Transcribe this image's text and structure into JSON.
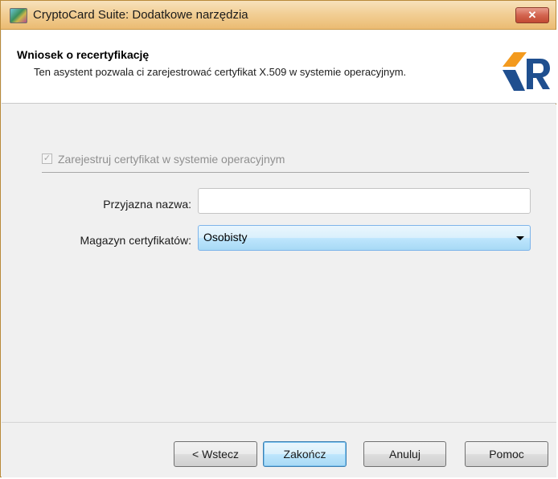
{
  "window": {
    "title": "CryptoCard Suite: Dodatkowe narzędzia",
    "close_label": "✕"
  },
  "header": {
    "title": "Wniosek o recertyfikację",
    "description": "Ten asystent pozwala ci zarejestrować certyfikat X.509 w systemie operacyjnym.",
    "logo_icon": "ccr-logo"
  },
  "form": {
    "register_checkbox": {
      "label": "Zarejestruj certyfikat w systemie operacyjnym",
      "checked": true,
      "enabled": false,
      "check_glyph": "✓"
    },
    "friendly_name": {
      "label": "Przyjazna nazwa:",
      "value": ""
    },
    "cert_store": {
      "label": "Magazyn certyfikatów:",
      "value": "Osobisty"
    }
  },
  "buttons": {
    "back": "< Wstecz",
    "finish": "Zakończ",
    "cancel": "Anuluj",
    "help": "Pomoc"
  },
  "colors": {
    "logo_orange": "#f39a1e",
    "logo_blue": "#1f4f8f",
    "title_bar": "#f2cf96"
  }
}
